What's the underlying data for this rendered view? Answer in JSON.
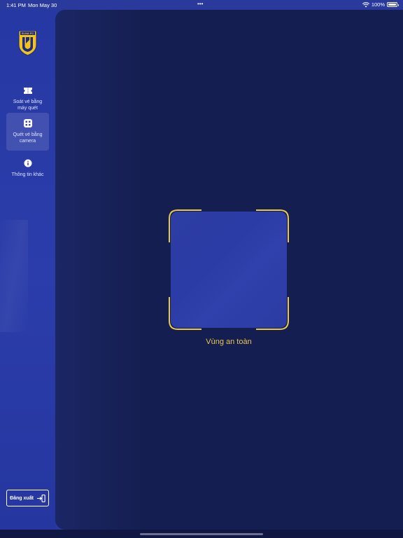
{
  "status_bar": {
    "time": "1:41 PM",
    "date": "Mon May 30",
    "battery": "100%"
  },
  "sidebar": {
    "logo_text": "SLNA FC",
    "items": [
      {
        "label": "Soát vé bằng máy quét",
        "icon": "scanner-icon",
        "active": false
      },
      {
        "label": "Quét vé bằng camera",
        "icon": "camera-scan-icon",
        "active": true
      },
      {
        "label": "Thông tin khác",
        "icon": "info-icon",
        "active": false
      }
    ],
    "logout_label": "Đăng xuất"
  },
  "camera": {
    "safe_zone_label": "Vùng an toàn"
  },
  "colors": {
    "accent": "#e8c84a",
    "sidebar_bg": "#2a3a9c",
    "panel_bg": "#141e50"
  }
}
